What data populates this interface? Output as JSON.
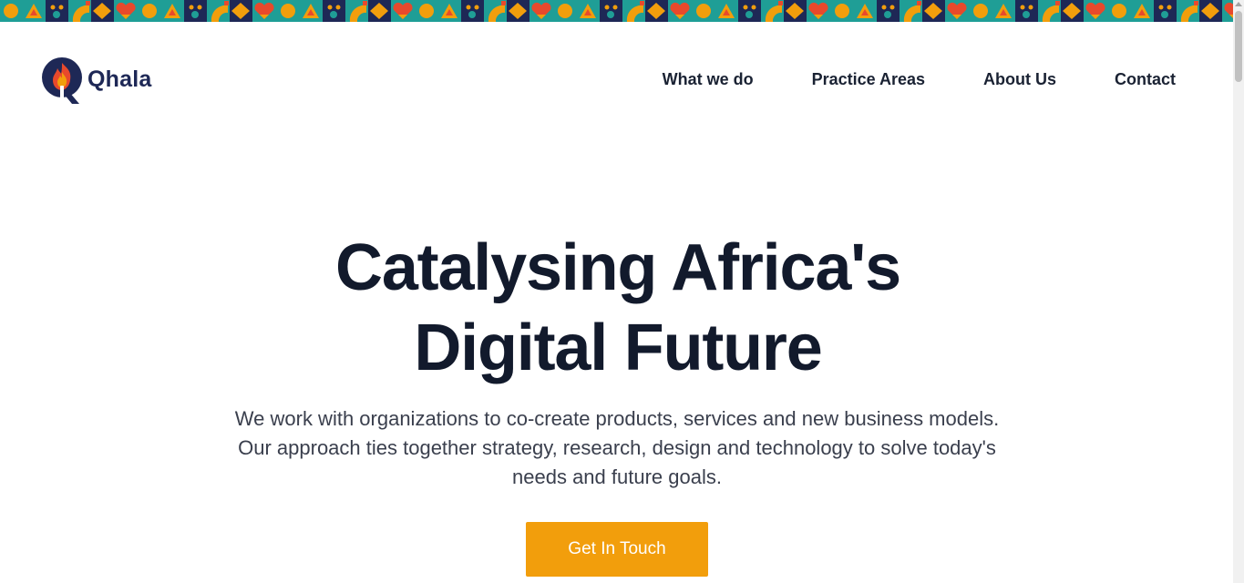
{
  "brand": {
    "name": "Qhala",
    "logo_icon": "flame-q-logo-icon",
    "colors": {
      "navy": "#1e2856",
      "orange": "#f29e0c",
      "teal": "#1f9e96",
      "red": "#e8492c"
    }
  },
  "nav": {
    "items": [
      {
        "label": "What we do"
      },
      {
        "label": "Practice Areas"
      },
      {
        "label": "About Us"
      },
      {
        "label": "Contact"
      }
    ]
  },
  "hero": {
    "title_line1": "Catalysing Africa's",
    "title_line2": "Digital Future",
    "subtitle_line1": "We work with organizations to co-create products, services and new business models.",
    "subtitle_line2": "Our approach ties together strategy, research, design and technology to solve today's",
    "subtitle_line3": "needs and future goals.",
    "cta_label": "Get In Touch"
  }
}
